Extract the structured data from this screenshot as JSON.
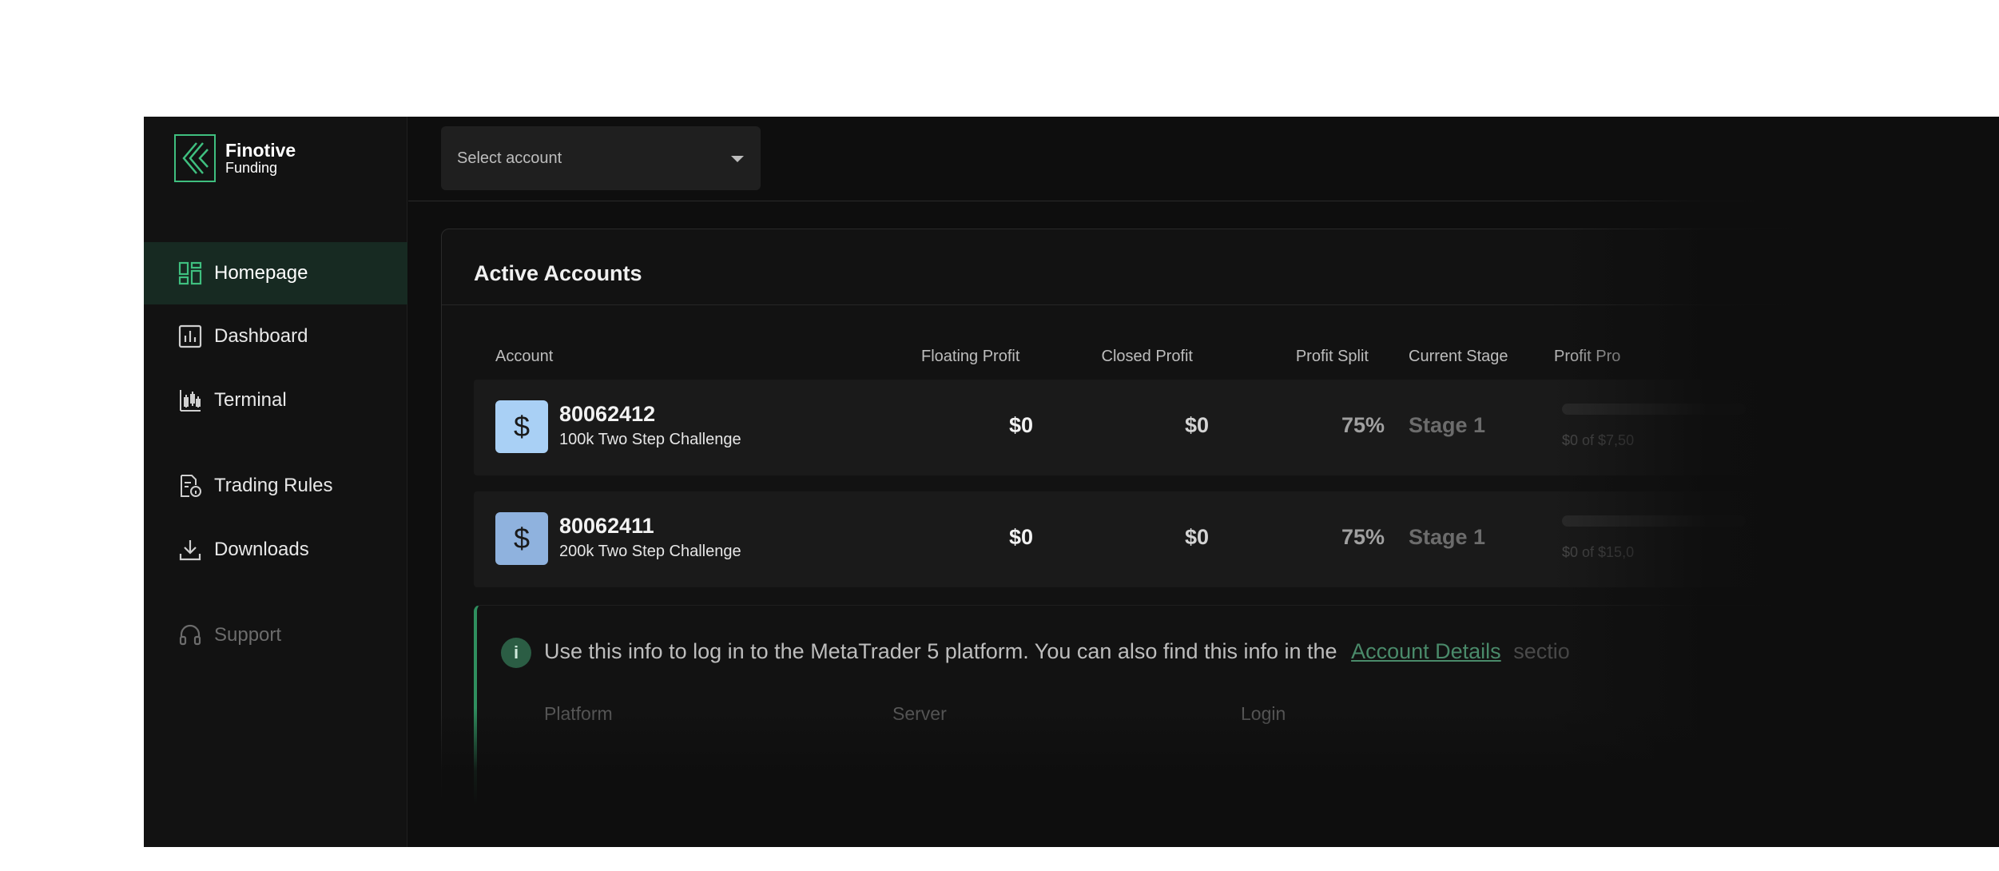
{
  "brand": {
    "name": "Finotive",
    "sub": "Funding"
  },
  "sidebar": {
    "items": [
      {
        "label": "Homepage",
        "icon": "grid-icon"
      },
      {
        "label": "Dashboard",
        "icon": "bar-chart-icon"
      },
      {
        "label": "Terminal",
        "icon": "candlestick-icon"
      },
      {
        "label": "Trading Rules",
        "icon": "document-info-icon"
      },
      {
        "label": "Downloads",
        "icon": "download-icon"
      },
      {
        "label": "Support",
        "icon": "headset-icon"
      }
    ]
  },
  "topbar": {
    "select_placeholder": "Select account"
  },
  "active_accounts": {
    "title": "Active Accounts",
    "columns": [
      "Account",
      "Floating Profit",
      "Closed Profit",
      "Profit Split",
      "Current Stage",
      "Profit Pro"
    ],
    "rows": [
      {
        "number": "80062412",
        "type": "100k Two Step Challenge",
        "floating": "$0",
        "closed": "$0",
        "split": "75%",
        "stage": "Stage 1",
        "progress_text": "$0 of $7,50",
        "avatar_color": "#a9d0f5"
      },
      {
        "number": "80062411",
        "type": "200k Two Step Challenge",
        "floating": "$0",
        "closed": "$0",
        "split": "75%",
        "stage": "Stage 1",
        "progress_text": "$0 of $15,0",
        "avatar_color": "#8fb2de"
      }
    ]
  },
  "info": {
    "text": "Use this info to log in to the MetaTrader 5 platform. You can also find this info in the",
    "link": "Account Details",
    "suffix": "sectio",
    "headers": [
      "Platform",
      "Server",
      "Login"
    ]
  },
  "colors": {
    "accent": "#3fbf7f",
    "active_bg": "#172a22"
  }
}
